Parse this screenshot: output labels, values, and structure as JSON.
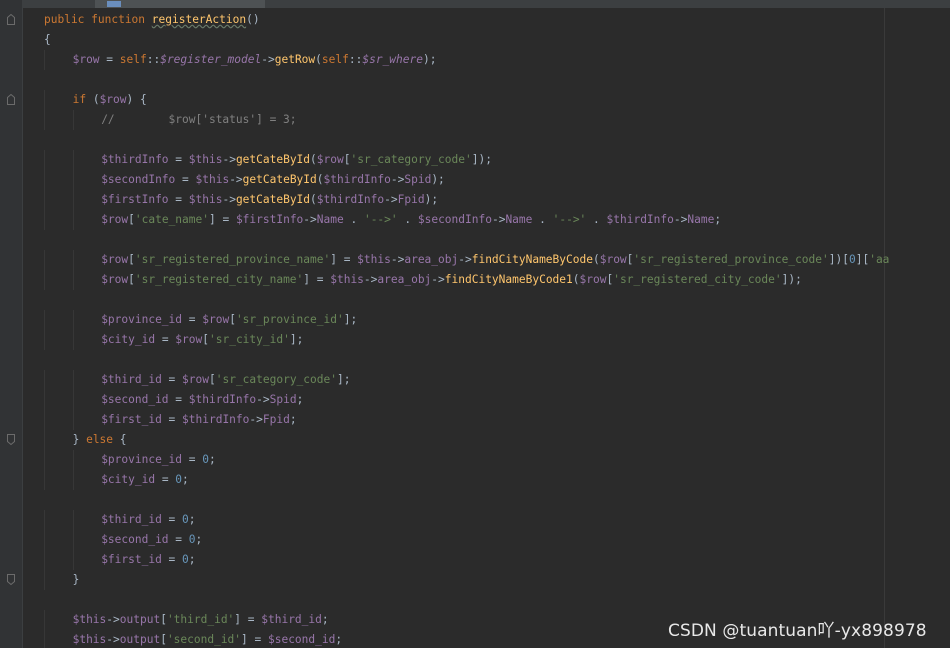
{
  "editor": {
    "lines": [
      {
        "indent": 0,
        "fold": "up",
        "tokens": [
          [
            "kw",
            "public function "
          ],
          [
            "fn ul",
            "registerAction"
          ],
          [
            "op",
            "()"
          ]
        ]
      },
      {
        "indent": 0,
        "tokens": [
          [
            "op",
            "{"
          ]
        ]
      },
      {
        "indent": 1,
        "tokens": [
          [
            "var",
            "$row"
          ],
          [
            "op",
            " = "
          ],
          [
            "kw",
            "self"
          ],
          [
            "op",
            "::"
          ],
          [
            "ivar",
            "$register_model"
          ],
          [
            "op",
            "->"
          ],
          [
            "fn",
            "getRow"
          ],
          [
            "op",
            "("
          ],
          [
            "kw",
            "self"
          ],
          [
            "op",
            "::"
          ],
          [
            "ivar",
            "$sr_where"
          ],
          [
            "op",
            ");"
          ]
        ]
      },
      {
        "indent": 0,
        "tokens": []
      },
      {
        "indent": 1,
        "fold": "up",
        "tokens": [
          [
            "kw",
            "if "
          ],
          [
            "op",
            "("
          ],
          [
            "var",
            "$row"
          ],
          [
            "op",
            ") {"
          ]
        ]
      },
      {
        "indent": 2,
        "tokens": [
          [
            "cm",
            "//        $row['status'] = 3;"
          ]
        ]
      },
      {
        "indent": 0,
        "tokens": []
      },
      {
        "indent": 2,
        "tokens": [
          [
            "var",
            "$thirdInfo"
          ],
          [
            "op",
            " = "
          ],
          [
            "var",
            "$this"
          ],
          [
            "op",
            "->"
          ],
          [
            "fn",
            "getCateById"
          ],
          [
            "op",
            "("
          ],
          [
            "var",
            "$row"
          ],
          [
            "op",
            "["
          ],
          [
            "str",
            "'sr_category_code'"
          ],
          [
            "op",
            "]);"
          ]
        ]
      },
      {
        "indent": 2,
        "tokens": [
          [
            "var",
            "$secondInfo"
          ],
          [
            "op",
            " = "
          ],
          [
            "var",
            "$this"
          ],
          [
            "op",
            "->"
          ],
          [
            "fn",
            "getCateById"
          ],
          [
            "op",
            "("
          ],
          [
            "var",
            "$thirdInfo"
          ],
          [
            "op",
            "->"
          ],
          [
            "var",
            "Spid"
          ],
          [
            "op",
            ");"
          ]
        ]
      },
      {
        "indent": 2,
        "tokens": [
          [
            "var",
            "$firstInfo"
          ],
          [
            "op",
            " = "
          ],
          [
            "var",
            "$this"
          ],
          [
            "op",
            "->"
          ],
          [
            "fn",
            "getCateById"
          ],
          [
            "op",
            "("
          ],
          [
            "var",
            "$thirdInfo"
          ],
          [
            "op",
            "->"
          ],
          [
            "var",
            "Fpid"
          ],
          [
            "op",
            ");"
          ]
        ]
      },
      {
        "indent": 2,
        "tokens": [
          [
            "var",
            "$row"
          ],
          [
            "op",
            "["
          ],
          [
            "str",
            "'cate_name'"
          ],
          [
            "op",
            "] = "
          ],
          [
            "var",
            "$firstInfo"
          ],
          [
            "op",
            "->"
          ],
          [
            "var",
            "Name"
          ],
          [
            "op",
            " . "
          ],
          [
            "str",
            "'-->'"
          ],
          [
            "op",
            " . "
          ],
          [
            "var",
            "$secondInfo"
          ],
          [
            "op",
            "->"
          ],
          [
            "var",
            "Name"
          ],
          [
            "op",
            " . "
          ],
          [
            "str",
            "'-->'"
          ],
          [
            "op",
            " . "
          ],
          [
            "var",
            "$thirdInfo"
          ],
          [
            "op",
            "->"
          ],
          [
            "var",
            "Name"
          ],
          [
            "op",
            ";"
          ]
        ]
      },
      {
        "indent": 0,
        "tokens": []
      },
      {
        "indent": 2,
        "tokens": [
          [
            "var",
            "$row"
          ],
          [
            "op",
            "["
          ],
          [
            "str",
            "'sr_registered_province_name'"
          ],
          [
            "op",
            "] = "
          ],
          [
            "var",
            "$this"
          ],
          [
            "op",
            "->"
          ],
          [
            "var",
            "area_obj"
          ],
          [
            "op",
            "->"
          ],
          [
            "fn",
            "findCityNameByCode"
          ],
          [
            "op",
            "("
          ],
          [
            "var",
            "$row"
          ],
          [
            "op",
            "["
          ],
          [
            "str",
            "'sr_registered_province_code'"
          ],
          [
            "op",
            "])["
          ],
          [
            "num",
            "0"
          ],
          [
            "op",
            "]["
          ],
          [
            "str",
            "'aa"
          ]
        ]
      },
      {
        "indent": 2,
        "tokens": [
          [
            "var",
            "$row"
          ],
          [
            "op",
            "["
          ],
          [
            "str",
            "'sr_registered_city_name'"
          ],
          [
            "op",
            "] = "
          ],
          [
            "var",
            "$this"
          ],
          [
            "op",
            "->"
          ],
          [
            "var",
            "area_obj"
          ],
          [
            "op",
            "->"
          ],
          [
            "fn",
            "findCityNameByCode1"
          ],
          [
            "op",
            "("
          ],
          [
            "var",
            "$row"
          ],
          [
            "op",
            "["
          ],
          [
            "str",
            "'sr_registered_city_code'"
          ],
          [
            "op",
            "]);"
          ]
        ]
      },
      {
        "indent": 0,
        "tokens": []
      },
      {
        "indent": 2,
        "tokens": [
          [
            "var",
            "$province_id"
          ],
          [
            "op",
            " = "
          ],
          [
            "var",
            "$row"
          ],
          [
            "op",
            "["
          ],
          [
            "str",
            "'sr_province_id'"
          ],
          [
            "op",
            "];"
          ]
        ]
      },
      {
        "indent": 2,
        "tokens": [
          [
            "var",
            "$city_id"
          ],
          [
            "op",
            " = "
          ],
          [
            "var",
            "$row"
          ],
          [
            "op",
            "["
          ],
          [
            "str",
            "'sr_city_id'"
          ],
          [
            "op",
            "];"
          ]
        ]
      },
      {
        "indent": 0,
        "tokens": []
      },
      {
        "indent": 2,
        "tokens": [
          [
            "var",
            "$third_id"
          ],
          [
            "op",
            " = "
          ],
          [
            "var",
            "$row"
          ],
          [
            "op",
            "["
          ],
          [
            "str",
            "'sr_category_code'"
          ],
          [
            "op",
            "];"
          ]
        ]
      },
      {
        "indent": 2,
        "tokens": [
          [
            "var",
            "$second_id"
          ],
          [
            "op",
            " = "
          ],
          [
            "var",
            "$thirdInfo"
          ],
          [
            "op",
            "->"
          ],
          [
            "var",
            "Spid"
          ],
          [
            "op",
            ";"
          ]
        ]
      },
      {
        "indent": 2,
        "tokens": [
          [
            "var",
            "$first_id"
          ],
          [
            "op",
            " = "
          ],
          [
            "var",
            "$thirdInfo"
          ],
          [
            "op",
            "->"
          ],
          [
            "var",
            "Fpid"
          ],
          [
            "op",
            ";"
          ]
        ]
      },
      {
        "indent": 1,
        "fold": "down",
        "tokens": [
          [
            "op",
            "} "
          ],
          [
            "kw",
            "else "
          ],
          [
            "op",
            "{"
          ]
        ]
      },
      {
        "indent": 2,
        "tokens": [
          [
            "var",
            "$province_id"
          ],
          [
            "op",
            " = "
          ],
          [
            "num",
            "0"
          ],
          [
            "op",
            ";"
          ]
        ]
      },
      {
        "indent": 2,
        "tokens": [
          [
            "var",
            "$city_id"
          ],
          [
            "op",
            " = "
          ],
          [
            "num",
            "0"
          ],
          [
            "op",
            ";"
          ]
        ]
      },
      {
        "indent": 0,
        "tokens": []
      },
      {
        "indent": 2,
        "tokens": [
          [
            "var",
            "$third_id"
          ],
          [
            "op",
            " = "
          ],
          [
            "num",
            "0"
          ],
          [
            "op",
            ";"
          ]
        ]
      },
      {
        "indent": 2,
        "tokens": [
          [
            "var",
            "$second_id"
          ],
          [
            "op",
            " = "
          ],
          [
            "num",
            "0"
          ],
          [
            "op",
            ";"
          ]
        ]
      },
      {
        "indent": 2,
        "tokens": [
          [
            "var",
            "$first_id"
          ],
          [
            "op",
            " = "
          ],
          [
            "num",
            "0"
          ],
          [
            "op",
            ";"
          ]
        ]
      },
      {
        "indent": 1,
        "fold": "down",
        "tokens": [
          [
            "op",
            "}"
          ]
        ]
      },
      {
        "indent": 0,
        "tokens": []
      },
      {
        "indent": 1,
        "tokens": [
          [
            "var",
            "$this"
          ],
          [
            "op",
            "->"
          ],
          [
            "var",
            "output"
          ],
          [
            "op",
            "["
          ],
          [
            "str",
            "'third_id'"
          ],
          [
            "op",
            "] = "
          ],
          [
            "var",
            "$third_id"
          ],
          [
            "op",
            ";"
          ]
        ]
      },
      {
        "indent": 1,
        "tokens": [
          [
            "var",
            "$this"
          ],
          [
            "op",
            "->"
          ],
          [
            "var",
            "output"
          ],
          [
            "op",
            "["
          ],
          [
            "str",
            "'second_id'"
          ],
          [
            "op",
            "] = "
          ],
          [
            "var",
            "$second_id"
          ],
          [
            "op",
            ";"
          ]
        ]
      }
    ]
  },
  "watermark": {
    "text": "CSDN @tuantuan吖-yx898978"
  },
  "colors": {
    "background": "#2b2b2b",
    "keyword": "#cc7832",
    "variable": "#9876aa",
    "string": "#6a8759",
    "number": "#6897bb",
    "function": "#ffc66d",
    "comment": "#808080",
    "text": "#a9b7c6"
  }
}
